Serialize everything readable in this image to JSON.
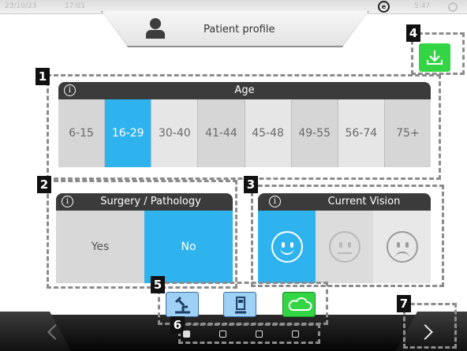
{
  "status_bar": {
    "date": "23/10/23",
    "time": "17:01",
    "brand_mark": "e",
    "right_text": "5:47"
  },
  "header": {
    "title": "Patient profile"
  },
  "annotations": [
    "1",
    "2",
    "3",
    "4",
    "5",
    "6",
    "7"
  ],
  "age": {
    "title": "Age",
    "options": [
      "6-15",
      "16-29",
      "30-40",
      "41-44",
      "45-48",
      "49-55",
      "56-74",
      "75+"
    ],
    "selected": "16-29"
  },
  "surgery": {
    "title": "Surgery / Pathology",
    "yes": "Yes",
    "no": "No",
    "selected": "No"
  },
  "vision": {
    "title": "Current Vision",
    "options": [
      "happy-face-icon",
      "neutral-face-icon",
      "sad-face-icon"
    ],
    "selected": "happy-face-icon"
  },
  "toolbar": {
    "modes": [
      "microscope-icon",
      "device-icon",
      "cloud-icon"
    ],
    "active": "cloud-icon"
  },
  "pagination": {
    "pages": 4,
    "current": 1
  },
  "colors": {
    "accent": "#2fb3ee",
    "success": "#34d545",
    "panel_header": "#3b3b3b",
    "light_blue": "#9fd0f5"
  }
}
